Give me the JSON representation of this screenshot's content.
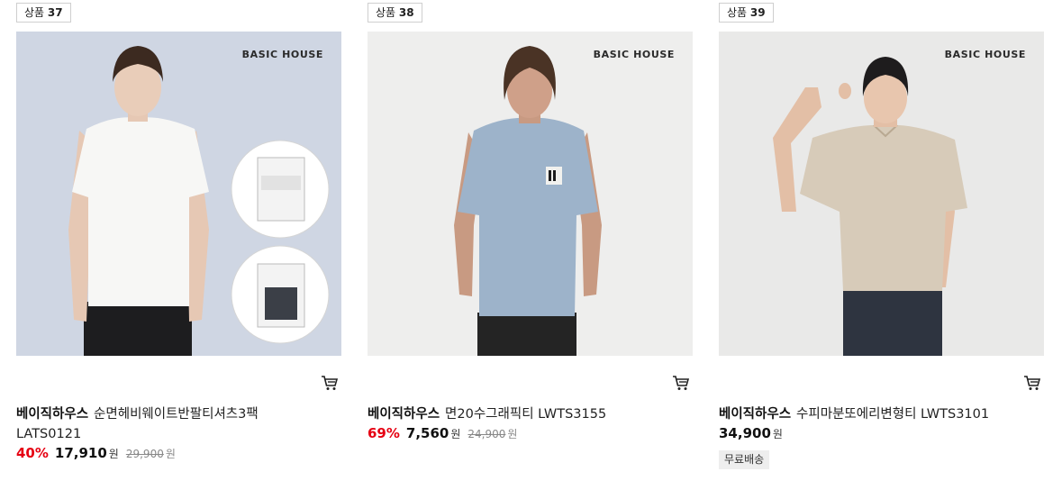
{
  "products": [
    {
      "rank_prefix": "상품",
      "rank": "37",
      "image_brand": "BASIC HOUSE",
      "brand": "베이직하우스",
      "name": "순면헤비웨이트반팔티셔츠3팩",
      "name_cont": "LATS0121",
      "discount": "40%",
      "price": "17,910",
      "currency": "원",
      "original_price": "29,900",
      "original_currency": "원",
      "colors": {
        "background": "#cfd6e3",
        "shirt": "#f7f7f5",
        "pants": "#1d1d1f"
      }
    },
    {
      "rank_prefix": "상품",
      "rank": "38",
      "image_brand": "BASIC HOUSE",
      "brand": "베이직하우스",
      "name": "면20수그래픽티 LWTS3155",
      "discount": "69%",
      "price": "7,560",
      "currency": "원",
      "original_price": "24,900",
      "original_currency": "원",
      "colors": {
        "background": "#eeeeed",
        "shirt": "#9db3ca",
        "pants": "#242424"
      }
    },
    {
      "rank_prefix": "상품",
      "rank": "39",
      "image_brand": "BASIC HOUSE",
      "brand": "베이직하우스",
      "name": "수피마분또에리변형티 LWTS3101",
      "price": "34,900",
      "currency": "원",
      "shipping_badge": "무료배송",
      "colors": {
        "background": "#e9e9e8",
        "shirt": "#d7cbb9",
        "pants": "#2e3440"
      }
    }
  ],
  "icons": {
    "cart": "shopping-cart-icon"
  },
  "colors": {
    "discount": "#e60012"
  }
}
